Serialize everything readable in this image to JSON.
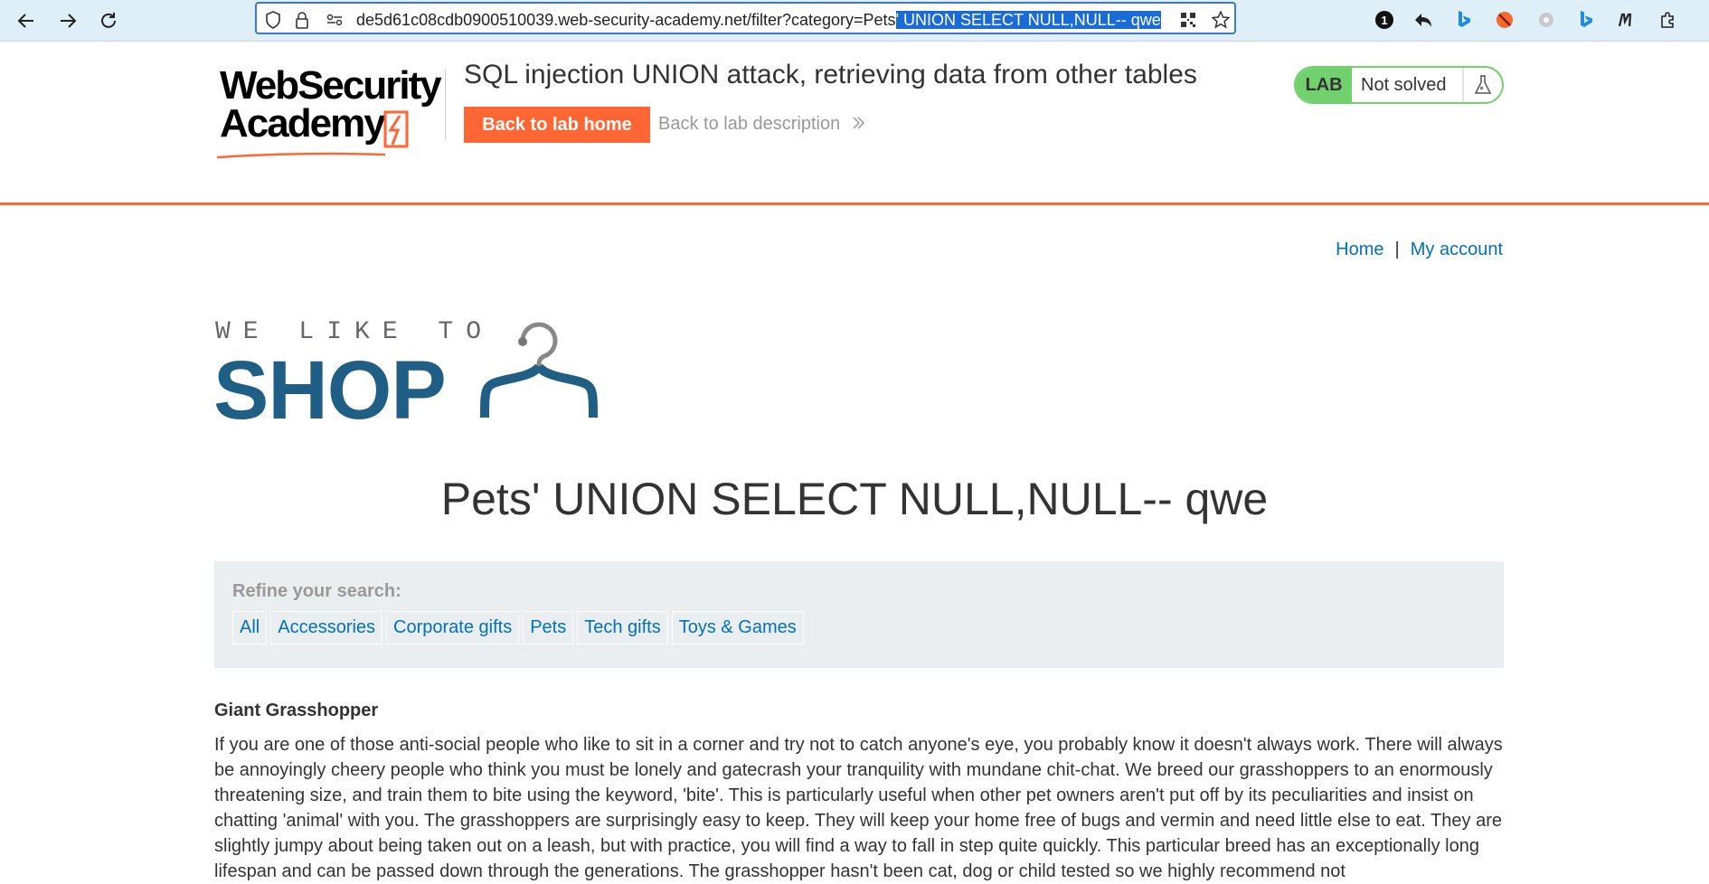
{
  "browser": {
    "url_plain": "de5d61c08cdb0900510039.web-security-academy.net/filter?category=Pets",
    "url_selected": "' UNION SELECT NULL,NULL-- qwe",
    "badge_count": "1"
  },
  "academy": {
    "logo_line1": "WebSecurity",
    "logo_line2": "Academy",
    "lab_title": "SQL injection UNION attack, retrieving data from other tables",
    "back_button": "Back to lab home",
    "description_link": "Back to lab description",
    "lab_label": "LAB",
    "lab_status": "Not solved"
  },
  "nav": {
    "home": "Home",
    "separator": "|",
    "account": "My account"
  },
  "shop": {
    "tagline": "WE LIKE TO",
    "word": "SHOP"
  },
  "page_title": "Pets' UNION SELECT NULL,NULL-- qwe",
  "filter": {
    "label": "Refine your search:",
    "categories": [
      "All",
      "Accessories",
      "Corporate gifts",
      "Pets",
      "Tech gifts",
      "Toys & Games"
    ]
  },
  "product": {
    "name": "Giant Grasshopper",
    "description": "If you are one of those anti-social people who like to sit in a corner and try not to catch anyone's eye, you probably know it doesn't always work. There will always be annoyingly cheery people who think you must be lonely and gatecrash your tranquility with mundane chit-chat. We breed our grasshoppers to an enormously threatening size, and train them to bite using the keyword, 'bite'. This is particularly useful when other pet owners aren't put off by its peculiarities and insist on chatting 'animal' with you. The grasshoppers are surprisingly easy to keep. They will keep your home free of bugs and vermin and need little else to eat. They are slightly jumpy about being taken out on a leash, but with practice, you will find a way to fall in step quite quickly. This particular breed has an exceptionally long lifespan and can be passed down through the generations. The grasshopper hasn't been cat, dog or child tested so we highly recommend not"
  },
  "colors": {
    "accent": "#ff6633",
    "link": "#0071bc",
    "shop_blue": "#1f5f86",
    "lab_green": "#70d16d"
  }
}
